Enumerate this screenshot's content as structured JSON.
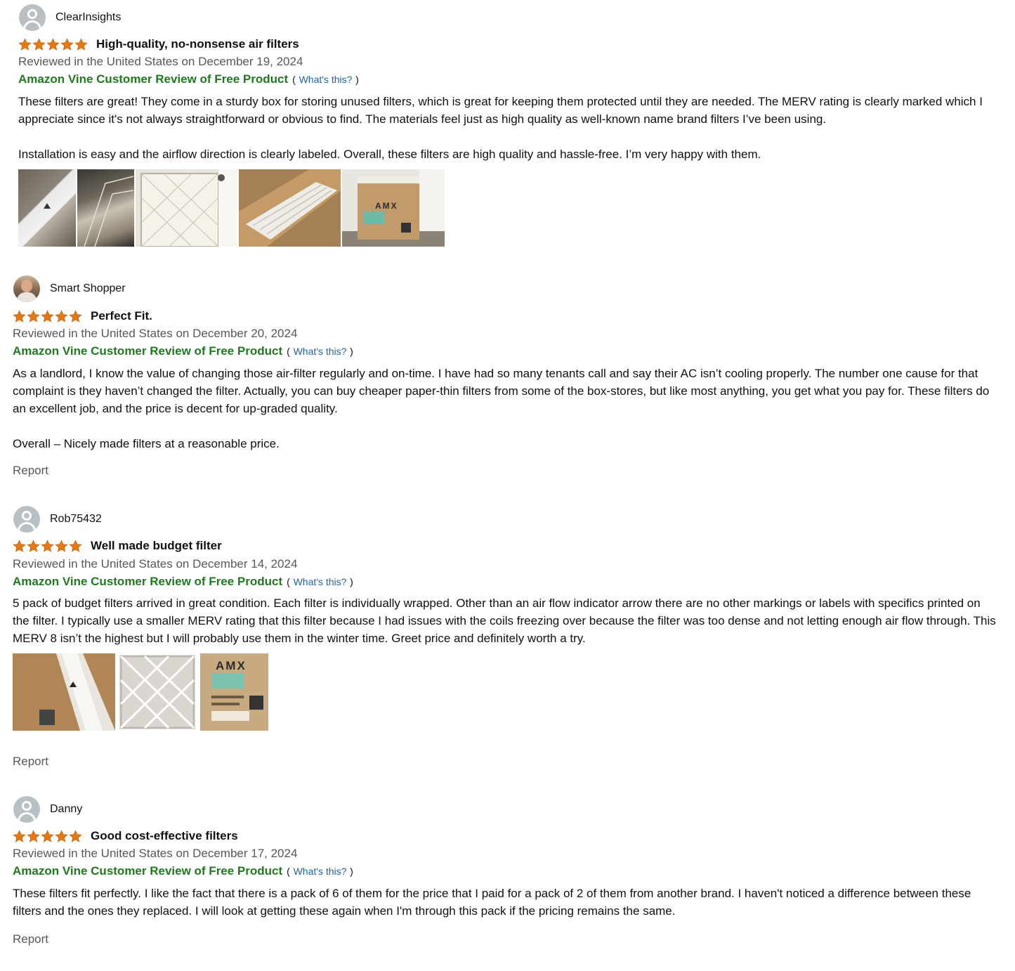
{
  "reviews": [
    {
      "reviewer": "ClearInsights",
      "rating": 5,
      "title": "High-quality, no-nonsense air filters",
      "date": "Reviewed in the United States on December 19, 2024",
      "vine_badge": "Amazon Vine Customer Review of Free Product",
      "vine_open": "(",
      "vine_link": "What's this?",
      "vine_close": ")",
      "body": [
        "These filters are great! They come in a sturdy box for storing unused filters, which is great for keeping them protected until they are needed. The MERV rating is clearly marked which I appreciate since it's not always straightforward or obvious to find. The materials feel just as high quality as well-known name brand filters I’ve been using.",
        "Installation is easy and the airflow direction is clearly labeled. Overall, these filters are high quality and hassle-free. I’m very happy with them."
      ],
      "images": [
        "filter-edge-photo",
        "filter-closeup-photo",
        "filter-installed-photo",
        "filters-in-box-photo",
        "amx-box-photo"
      ],
      "amx_text": "AMX"
    },
    {
      "reviewer": "Smart Shopper",
      "rating": 5,
      "title": "Perfect Fit.",
      "date": "Reviewed in the United States on December 20, 2024",
      "vine_badge": "Amazon Vine Customer Review of Free Product",
      "vine_open": "(",
      "vine_link": "What's this?",
      "vine_close": ")",
      "body": [
        "As a landlord, I know the value of changing those air-filter regularly and on-time. I have had so many tenants call and say their AC isn’t cooling properly. The number one cause for that complaint is they haven’t changed the filter. Actually, you can buy cheaper paper-thin filters from some of the box-stores, but like most anything, you get what you pay for. These filters do an excellent job, and the price is decent for up-graded quality.",
        "Overall – Nicely made filters at a reasonable price."
      ],
      "report": "Report"
    },
    {
      "reviewer": "Rob75432",
      "rating": 5,
      "title": "Well made budget filter",
      "date": "Reviewed in the United States on December 14, 2024",
      "vine_badge": "Amazon Vine Customer Review of Free Product",
      "vine_open": "(",
      "vine_link": "What's this?",
      "vine_close": ")",
      "body": [
        "5 pack of budget filters arrived in great condition. Each filter is individually wrapped. Other than an air flow indicator arrow there are no other markings or labels with specifics printed on the filter. I typically use a smaller MERV rating that this filter because I had issues with the coils freezing over because the filter was too dense and not letting enough air flow through. This MERV 8 isn’t the highest but I will probably use them in the winter time. Greet price and definitely worth a try."
      ],
      "images": [
        "wrapped-filter-photo",
        "filter-pleats-photo",
        "amx-label-photo"
      ],
      "amx_text": "AMX",
      "report": "Report"
    },
    {
      "reviewer": "Danny",
      "rating": 5,
      "title": "Good cost-effective filters",
      "date": "Reviewed in the United States on December 17, 2024",
      "vine_badge": "Amazon Vine Customer Review of Free Product",
      "vine_open": "(",
      "vine_link": "What's this?",
      "vine_close": ")",
      "body": [
        "These filters fit perfectly. I like the fact that there is a pack of 6 of them for the price that I paid for a pack of 2 of them from another brand. I haven't noticed a difference between these filters and the ones they replaced. I will look at getting these again when I'm through this pack if the pricing remains the same."
      ],
      "report": "Report"
    }
  ],
  "colors": {
    "star": "#e47911",
    "vine_green": "#1f7a1f",
    "link_blue": "#2162a1",
    "muted_text": "#565959"
  }
}
